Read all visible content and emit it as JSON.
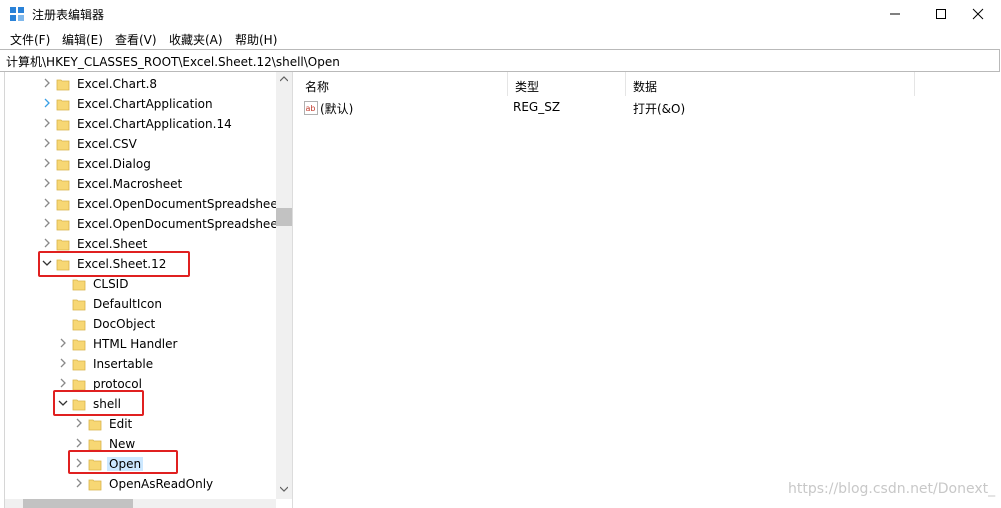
{
  "window": {
    "title": "注册表编辑器"
  },
  "menu": [
    "文件(F)",
    "编辑(E)",
    "查看(V)",
    "收藏夹(A)",
    "帮助(H)"
  ],
  "address": "计算机\\HKEY_CLASSES_ROOT\\Excel.Sheet.12\\shell\\Open",
  "tree": [
    {
      "label": "Excel.Chart.8",
      "expanded": false
    },
    {
      "label": "Excel.ChartApplication",
      "expanded": false
    },
    {
      "label": "Excel.ChartApplication.14",
      "expanded": false
    },
    {
      "label": "Excel.CSV",
      "expanded": false
    },
    {
      "label": "Excel.Dialog",
      "expanded": false
    },
    {
      "label": "Excel.Macrosheet",
      "expanded": false
    },
    {
      "label": "Excel.OpenDocumentSpreadsheet",
      "expanded": false
    },
    {
      "label": "Excel.OpenDocumentSpreadsheet",
      "expanded": false
    },
    {
      "label": "Excel.Sheet",
      "expanded": false
    },
    {
      "label": "Excel.Sheet.12",
      "expanded": true
    },
    {
      "label": "CLSID",
      "expanded": false
    },
    {
      "label": "DefaultIcon",
      "expanded": false
    },
    {
      "label": "DocObject",
      "expanded": false
    },
    {
      "label": "HTML Handler",
      "expanded": false
    },
    {
      "label": "Insertable",
      "expanded": false
    },
    {
      "label": "protocol",
      "expanded": false
    },
    {
      "label": "shell",
      "expanded": true
    },
    {
      "label": "Edit",
      "expanded": false
    },
    {
      "label": "New",
      "expanded": false
    },
    {
      "label": "Open",
      "expanded": false,
      "selected": true
    },
    {
      "label": "OpenAsReadOnly",
      "expanded": false
    }
  ],
  "list": {
    "headers": {
      "name": "名称",
      "type": "类型",
      "data": "数据"
    },
    "rows": [
      {
        "name": "(默认)",
        "type": "REG_SZ",
        "data": "打开(&O)",
        "icon": "string-value-icon"
      }
    ]
  },
  "watermark": "https://blog.csdn.net/Donext_",
  "colors": {
    "highlight_box": "#e02020",
    "folder": "#f7d774",
    "selection": "#cce8ff"
  }
}
